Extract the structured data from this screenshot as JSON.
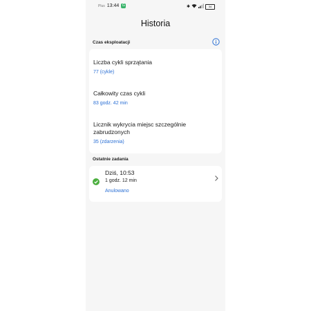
{
  "status_bar": {
    "carrier": "Plus",
    "time": "13:44",
    "notification_badge": "G",
    "battery": "34"
  },
  "header": {
    "title": "Historia"
  },
  "usage": {
    "section_title": "Czas eksploatacji",
    "info_icon": "info-icon",
    "items": [
      {
        "label": "Liczba cykli sprzątania",
        "value": "77 (cykle)"
      },
      {
        "label": "Całkowity czas cykli",
        "value": "83 godz. 42 min"
      },
      {
        "label": "Licznik wykrycia miejsc szczególnie zabrudzonych",
        "value": "35 (zdarzenia)"
      }
    ]
  },
  "recent": {
    "section_title": "Ostatnie zadania",
    "tasks": [
      {
        "time": "Dziś, 10:53",
        "duration": "1 godz. 12 min",
        "status": "Anulowano",
        "icon": "check-circle-icon"
      }
    ]
  },
  "colors": {
    "accent": "#2a6fd4",
    "success": "#4caf3f",
    "background": "#f6f6f6"
  }
}
